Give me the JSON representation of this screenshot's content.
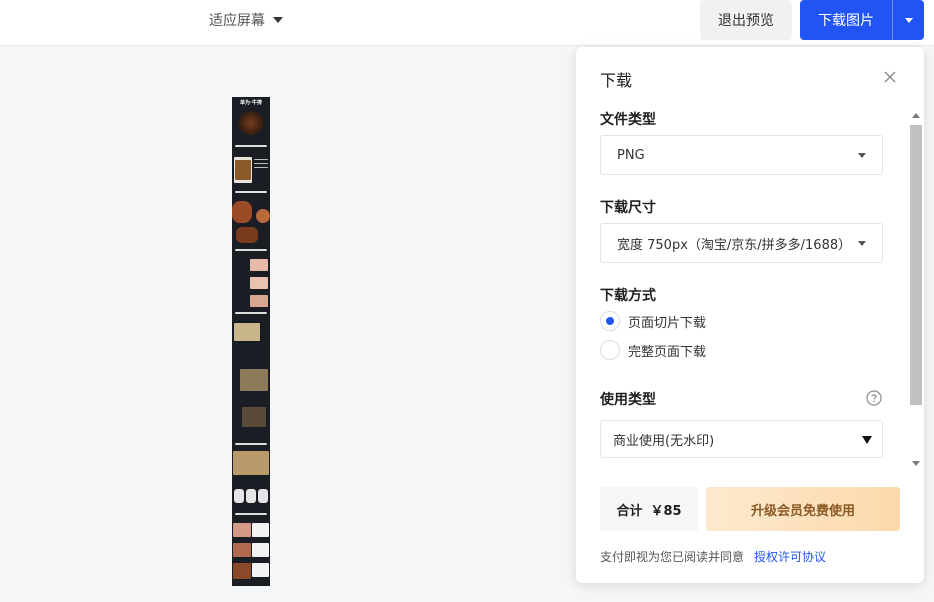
{
  "toolbar": {
    "fit_label": "适应屏幕",
    "exit_preview_label": "退出预览",
    "download_image_label": "下载图片"
  },
  "preview": {
    "thumb_title": "单为·牛排"
  },
  "panel": {
    "title": "下载",
    "file_type": {
      "label": "文件类型",
      "value": "PNG"
    },
    "download_size": {
      "label": "下载尺寸",
      "value": "宽度 750px（淘宝/京东/拼多多/1688）"
    },
    "download_mode": {
      "label": "下载方式",
      "options": [
        {
          "label": "页面切片下载",
          "checked": true
        },
        {
          "label": "完整页面下载",
          "checked": false
        }
      ]
    },
    "usage_type": {
      "label": "使用类型",
      "value": "商业使用(无水印)"
    },
    "total": {
      "label": "合计",
      "amount": "￥85"
    },
    "upgrade_label": "升级会员免费使用",
    "agreement_text": "支付即视为您已阅读并同意",
    "agreement_link": "授权许可协议"
  },
  "colors": {
    "primary": "#2254f4",
    "upgrade_bg": "#fcd9ab",
    "upgrade_text": "#8a5a24"
  }
}
